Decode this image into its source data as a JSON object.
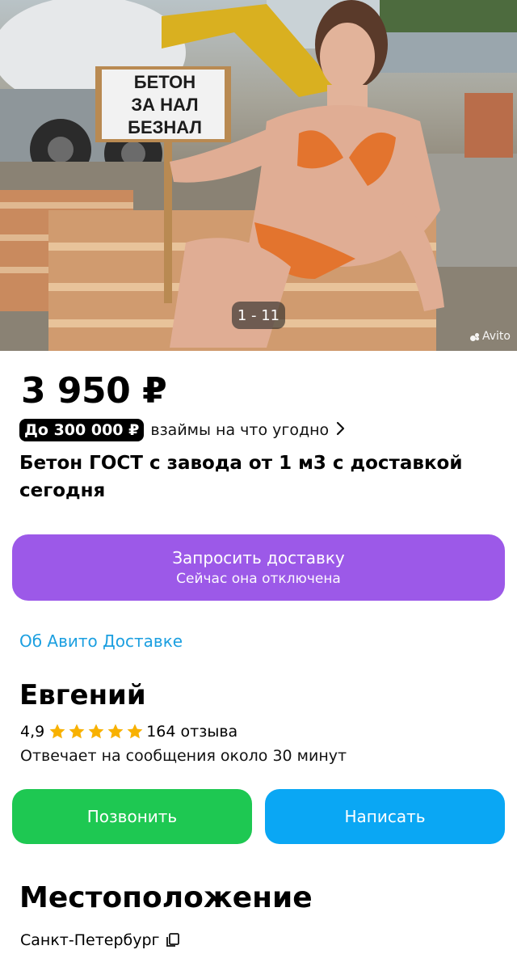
{
  "gallery": {
    "sign_lines": [
      "БЕТОН",
      "ЗА НАЛ",
      "БЕЗНАЛ"
    ],
    "counter": "1 - 11",
    "watermark": "Avito"
  },
  "listing": {
    "price": "3 950 ₽",
    "loan_badge": "До 300 000 ₽",
    "loan_text": "взаймы на что угодно",
    "loan_icon": "chevron-right-icon",
    "title": "Бетон ГОСТ с завода от 1 м3 с доставкой сегодня"
  },
  "delivery": {
    "button_label": "Запросить доставку",
    "button_sublabel": "Сейчас она отключена",
    "about_link": "Об Авито Доставке"
  },
  "seller": {
    "name": "Евгений",
    "rating": "4,9",
    "stars": 5,
    "reviews": "164 отзыва",
    "reply_time": "Отвечает на сообщения около 30 минут",
    "call_label": "Позвонить",
    "message_label": "Написать"
  },
  "location": {
    "heading": "Местоположение",
    "city": "Санкт-Петербург",
    "city_icon": "copy-icon"
  },
  "colors": {
    "delivery_button": "#9c59e8",
    "call_button": "#1ec852",
    "message_button": "#0aa7f4",
    "link": "#1b9fe0",
    "star": "#f8b100"
  }
}
